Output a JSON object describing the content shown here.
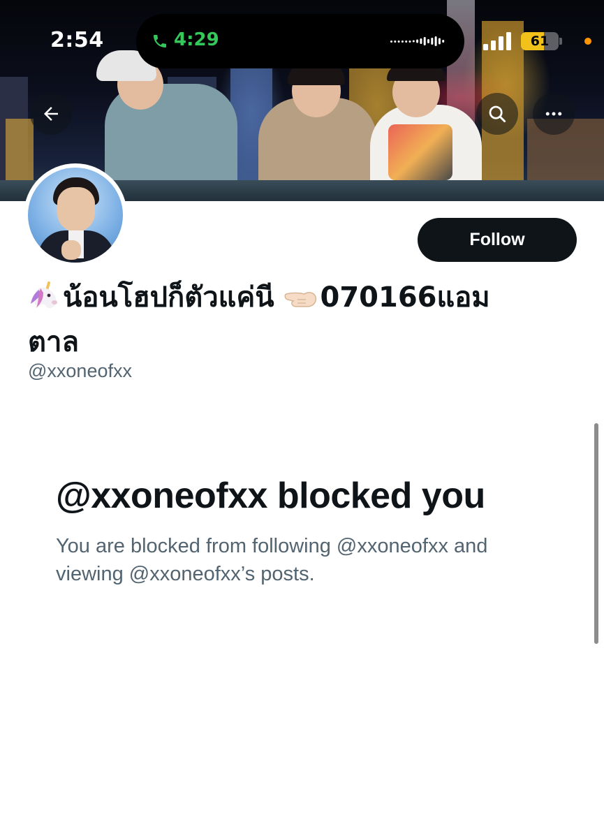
{
  "status_bar": {
    "time": "2:54",
    "call_duration": "4:29",
    "battery_level": "61",
    "battery_fraction": 0.61,
    "icons": [
      "phone-icon",
      "audio-waveform-icon",
      "cellular-signal-icon",
      "battery-icon",
      "privacy-indicator-dot"
    ]
  },
  "header": {
    "icons": [
      "back-arrow-icon",
      "search-icon",
      "more-icon"
    ]
  },
  "profile": {
    "display_name_part1": "น้อนโฮปก็ตัวแค่นี",
    "display_name_part2": "070166แอมตาล",
    "name_emojis": [
      "unicorn-icon",
      "pointing-hand-icon"
    ],
    "handle": "@xxoneofxx",
    "follow_label": "Follow"
  },
  "blocked": {
    "title": "@xxoneofxx blocked you",
    "description": "You are blocked from following @xxoneofxx and viewing @xxoneofxx’s posts."
  },
  "colors": {
    "text_primary": "#0f1419",
    "text_secondary": "#536471",
    "follow_button_bg": "#0f1419",
    "call_green": "#34c759",
    "battery_yellow": "#f2c21a",
    "privacy_dot": "#ff9500"
  }
}
